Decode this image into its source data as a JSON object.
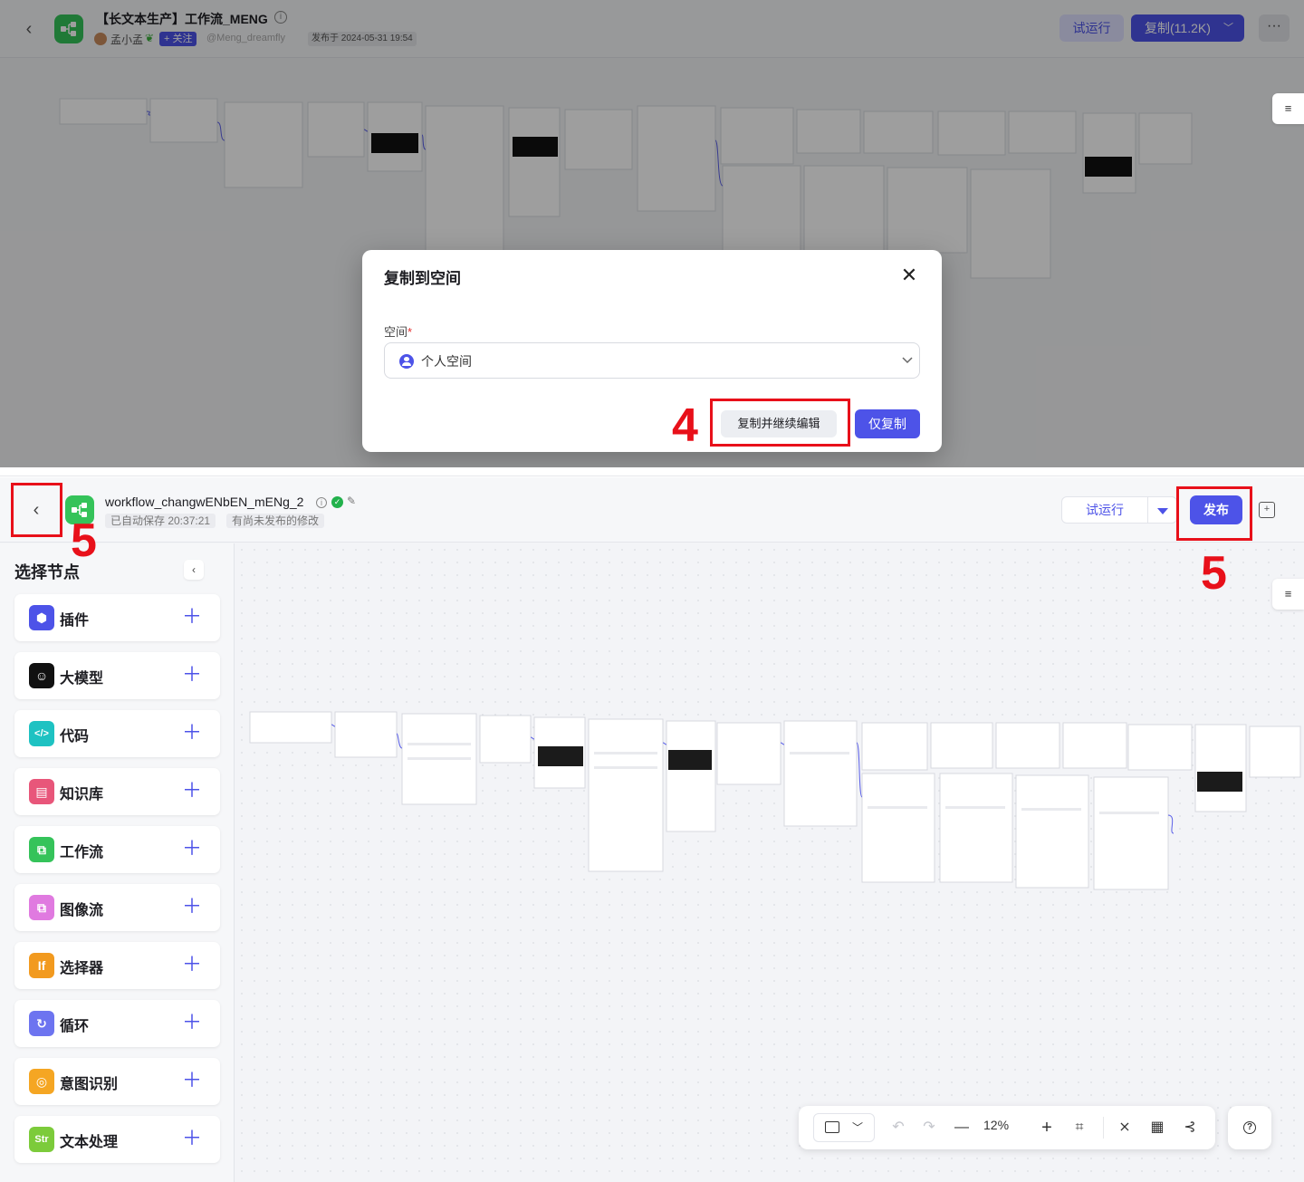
{
  "top": {
    "title": "【长文本生产】工作流_MENG",
    "author_name": "孟小孟",
    "follow_label": "+ 关注",
    "author_handle": "@Meng_dreamfly",
    "publish_date": "发布于 2024-05-31 19:54",
    "trial_run_label": "试运行",
    "copy_label": "复制(11.2K)",
    "more_label": "···"
  },
  "modal": {
    "title": "复制到空间",
    "field_label": "空间",
    "required_mark": "*",
    "space_value": "个人空间",
    "copy_continue_label": "复制并继续编辑",
    "copy_only_label": "仅复制"
  },
  "bottom": {
    "title": "workflow_changwENbEN_mENg_2",
    "autosave": "已自动保存 20:37:21",
    "unpublished": "有尚未发布的修改",
    "trial_run_label": "试运行",
    "publish_label": "发布"
  },
  "sidebar": {
    "title": "选择节点",
    "items": [
      {
        "label": "插件",
        "icon": "plugin-icon",
        "color": "#4d53e8",
        "glyph": "⬢"
      },
      {
        "label": "大模型",
        "icon": "llm-icon",
        "color": "#111111",
        "glyph": "☺"
      },
      {
        "label": "代码",
        "icon": "code-icon",
        "color": "#1ec2c2",
        "glyph": "</>"
      },
      {
        "label": "知识库",
        "icon": "knowledge-icon",
        "color": "#e8567a",
        "glyph": "▤"
      },
      {
        "label": "工作流",
        "icon": "workflow-icon",
        "color": "#35c35a",
        "glyph": "⧉"
      },
      {
        "label": "图像流",
        "icon": "imageflow-icon",
        "color": "#e07ae0",
        "glyph": "⧉"
      },
      {
        "label": "选择器",
        "icon": "selector-icon",
        "color": "#f29a1f",
        "glyph": "If"
      },
      {
        "label": "循环",
        "icon": "loop-icon",
        "color": "#6d74f0",
        "glyph": "↻"
      },
      {
        "label": "意图识别",
        "icon": "intent-icon",
        "color": "#f5a623",
        "glyph": "◎"
      },
      {
        "label": "文本处理",
        "icon": "text-process-icon",
        "color": "#7ccb3b",
        "glyph": "Str"
      }
    ]
  },
  "toolbar": {
    "zoom": "12%"
  },
  "annotations": {
    "step4": "4",
    "step5_left": "5",
    "step5_right": "5"
  },
  "colors": {
    "accent": "#4d53e8",
    "annotation": "#e8101a",
    "workflow_green": "#35c35a"
  }
}
